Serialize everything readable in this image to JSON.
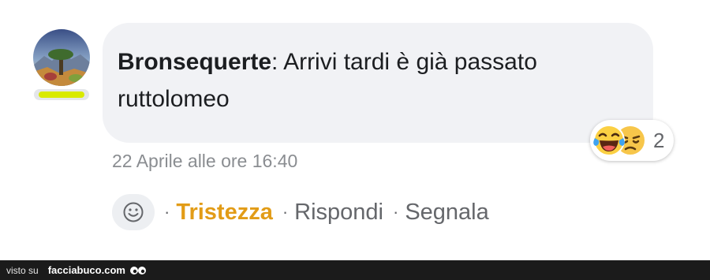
{
  "comment": {
    "author": "Bronsequerte",
    "separator": ":",
    "text": " Arrivi tardi è già passato ruttolomeo",
    "timestamp": "22 Aprile alle ore 16:40"
  },
  "reactions": {
    "count": "2",
    "icons": [
      "laughing-tears-emoji",
      "sad-emoji"
    ]
  },
  "actions": {
    "dot": "·",
    "reaction_label": "Tristezza",
    "reply_label": "Rispondi",
    "report_label": "Segnala"
  },
  "footer": {
    "visto_su": "visto su",
    "site": "facciabuco.com"
  },
  "colors": {
    "bubble": "#f1f2f5",
    "sad_reaction": "#e29c17",
    "badge": "#d9ea00",
    "footer_bg": "#1b1b1b"
  }
}
